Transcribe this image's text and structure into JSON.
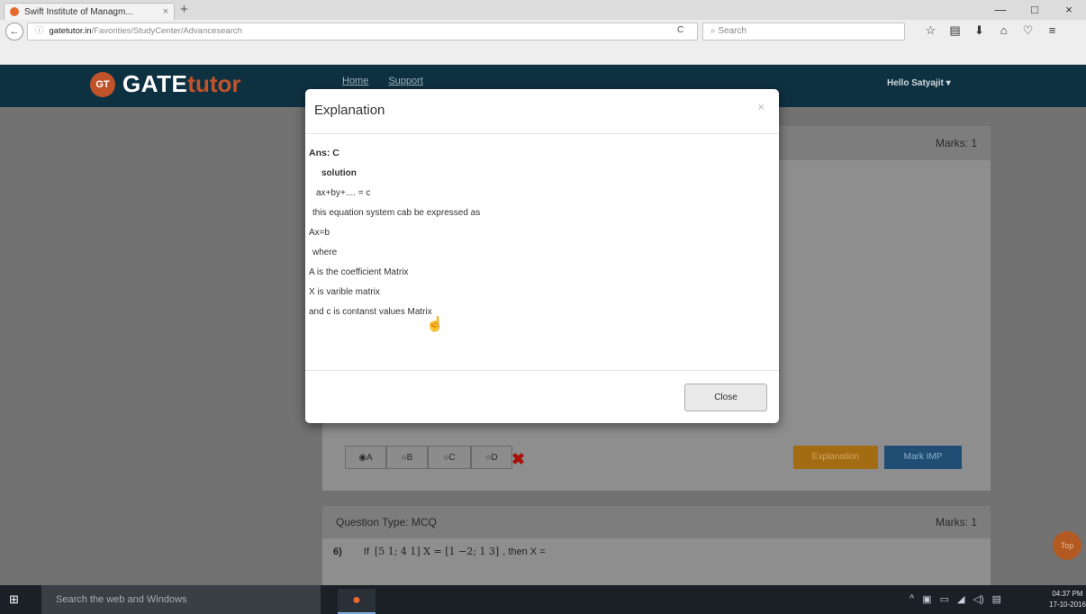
{
  "browser": {
    "tab_title": "Swift Institute of Managm...",
    "tab_close": "×",
    "new_tab": "+",
    "win_minimize": "—",
    "win_maximize": "□",
    "win_close": "×",
    "back": "←",
    "url_host": "gatetutor.in",
    "url_path": "/Favorities/StudyCenter/Advancesearch",
    "reload": "C",
    "search_placeholder": "Search",
    "search_icon": "⌕"
  },
  "site": {
    "logo_badge": "GT",
    "logo_gate": "GATE",
    "logo_tutor": "tutor",
    "nav": [
      "Home",
      "Support"
    ],
    "user": "Hello Satyajit ▾"
  },
  "question_prev": {
    "marks": "Marks: 1",
    "options": [
      "◉A",
      "○B",
      "○C",
      "○D"
    ],
    "wrong_mark": "✖",
    "explanation_button": "Explanation",
    "mark_imp_button": "Mark IMP"
  },
  "question_next": {
    "type": "Question Type: MCQ",
    "marks": "Marks: 1",
    "number": "6)",
    "text_if": "If",
    "text_then": ", then X ="
  },
  "top_button": "Top",
  "modal": {
    "title": "Explanation",
    "close_x": "×",
    "answer": "Ans: C",
    "solution_heading": "solution",
    "lines": [
      "ax+by+.... = c",
      "this equation system cab be expressed as",
      "Ax=b",
      "where",
      "A is the coefficient Matrix",
      "X is varible matrix",
      "and c is contanst values Matrix"
    ],
    "close_button": "Close"
  },
  "taskbar": {
    "start": "⊞",
    "search": "Search the web and Windows",
    "time": "04:37 PM",
    "date": "17-10-2016"
  }
}
